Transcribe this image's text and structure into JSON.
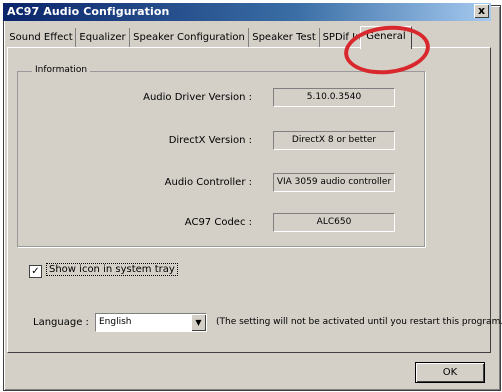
{
  "window": {
    "title": "AC97 Audio Configuration",
    "close_glyph": "x"
  },
  "tabs": [
    {
      "label": "Sound Effect"
    },
    {
      "label": "Equalizer"
    },
    {
      "label": "Speaker Configuration"
    },
    {
      "label": "Speaker Test"
    },
    {
      "label": "SPDif In"
    },
    {
      "label": "General"
    }
  ],
  "selected_tab": "General",
  "information": {
    "group_title": "Information",
    "rows": [
      {
        "label": "Audio Driver Version :",
        "value": "5.10.0.3540"
      },
      {
        "label": "DirectX Version :",
        "value": "DirectX 8 or better"
      },
      {
        "label": "Audio Controller :",
        "value": "VIA 3059 audio controller"
      },
      {
        "label": "AC97 Codec :",
        "value": "ALC650"
      }
    ]
  },
  "show_icon": {
    "checked": true,
    "check_glyph": "✓",
    "label": "Show icon in system tray"
  },
  "language": {
    "label": "Language :",
    "selected": "English",
    "arrow_glyph": "▼"
  },
  "note": "(The setting will not be activated until you restart this program.)",
  "ok_label": "OK",
  "colors": {
    "annotation_circle": "#d8282e",
    "dialog_face": "#d4d0c8"
  }
}
